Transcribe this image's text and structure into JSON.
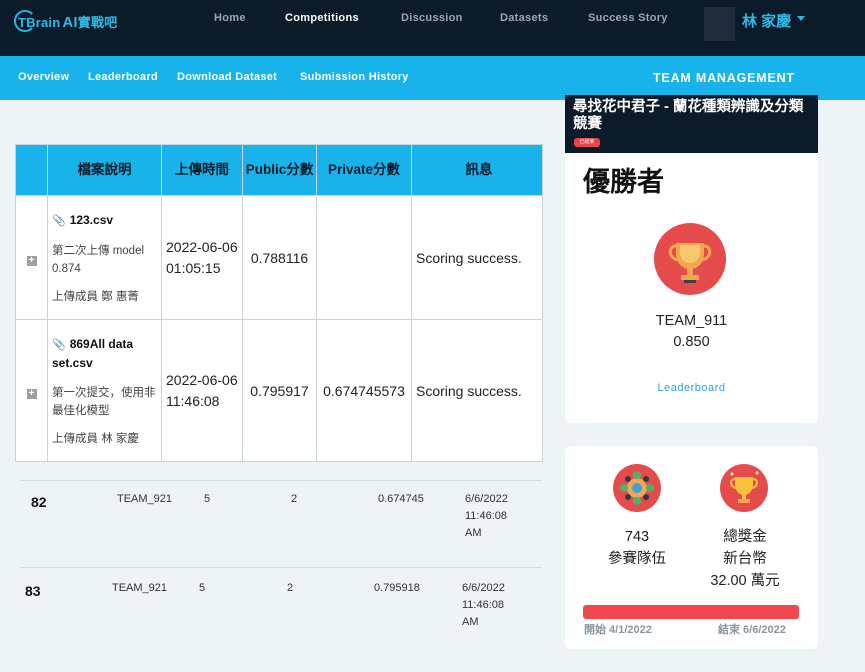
{
  "nav": {
    "logo": {
      "brand": "TBrain",
      "ai": "AI",
      "suffix": "實戰吧"
    },
    "links": [
      "Home",
      "Competitions",
      "Discussion",
      "Datasets",
      "Success Story"
    ],
    "user_name": "林 家慶"
  },
  "subnav": {
    "links": [
      "Overview",
      "Leaderboard",
      "Download Dataset",
      "Submission History"
    ],
    "team_management": "TEAM MANAGEMENT"
  },
  "upload_table": {
    "headers": [
      "檔案說明",
      "上傳時間",
      "Public分數",
      "Private分數",
      "訊息"
    ],
    "rows": [
      {
        "file": "123.csv",
        "description": "第二次上傳 model 0.874",
        "member": "上傳成員 鄭 惠菁",
        "time": "2022-06-06 01:05:15",
        "public": "0.788116",
        "private": "",
        "message": "Scoring success."
      },
      {
        "file": "869All data set.csv",
        "description": "第一次提交，使用非最佳化模型",
        "member": "上傳成員 林 家慶",
        "time": "2022-06-06 11:46:08",
        "public": "0.795917",
        "private": "0.674745573",
        "message": "Scoring success."
      }
    ]
  },
  "leaderboard_rows": [
    {
      "rank": "82",
      "team": "TEAM_921",
      "members": "5",
      "entries": "2",
      "score": "0.674745",
      "date": "6/6/2022",
      "time": "11:46:08",
      "ampm": "AM"
    },
    {
      "rank": "83",
      "team": "TEAM_921",
      "members": "5",
      "entries": "2",
      "score": "0.795918",
      "date": "6/6/2022",
      "time": "11:46:08",
      "ampm": "AM"
    }
  ],
  "competition": {
    "title": "尋找花中君子 - 蘭花種類辨識及分類競賽",
    "badge": "已結束",
    "winner_title": "優勝者",
    "winner_team": "TEAM_911",
    "winner_score": "0.850",
    "leaderboard_link": "Leaderboard"
  },
  "stats": {
    "teams_count": "743",
    "teams_label": "參賽隊伍",
    "prize_label": "總獎金",
    "prize_currency": "新台幣",
    "prize_amount": "32.00 萬元",
    "progress": 1.0,
    "start_label": "開始 4/1/2022",
    "end_label": "結束 6/6/2022"
  },
  "colors": {
    "nav_bg": "#0c1b2a",
    "accent": "#19b3eb",
    "red": "#e64b4b"
  }
}
